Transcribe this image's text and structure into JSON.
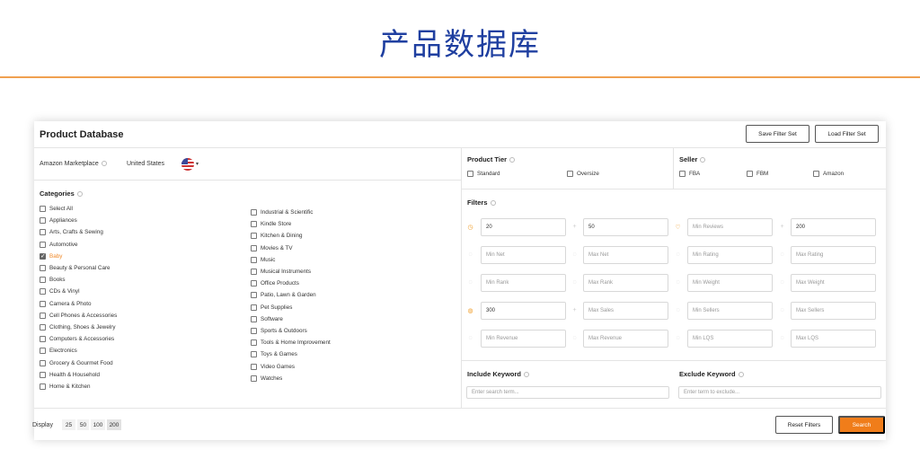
{
  "slide_title": "产品数据库",
  "header": {
    "title": "Product Database",
    "save_filter_set": "Save Filter Set",
    "load_filter_set": "Load Filter Set"
  },
  "marketplace": {
    "label": "Amazon Marketplace",
    "value": "United States"
  },
  "categories": {
    "title": "Categories",
    "col1": [
      "Select All",
      "Appliances",
      "Arts, Crafts & Sewing",
      "Automotive",
      "Baby",
      "Beauty & Personal Care",
      "Books",
      "CDs & Vinyl",
      "Camera & Photo",
      "Cell Phones & Accessories",
      "Clothing, Shoes & Jewelry",
      "Computers & Accessories",
      "Electronics",
      "Grocery & Gourmet Food",
      "Health & Household",
      "Home & Kitchen"
    ],
    "col2": [
      "Industrial & Scientific",
      "Kindle Store",
      "Kitchen & Dining",
      "Movies & TV",
      "Music",
      "Musical Instruments",
      "Office Products",
      "Patio, Lawn & Garden",
      "Pet Supplies",
      "Software",
      "Sports & Outdoors",
      "Tools & Home Improvement",
      "Toys & Games",
      "Video Games",
      "Watches"
    ],
    "checked": "Baby"
  },
  "product_tier": {
    "title": "Product Tier",
    "options": [
      "Standard",
      "Oversize"
    ]
  },
  "seller": {
    "title": "Seller",
    "options": [
      "FBA",
      "FBM",
      "Amazon"
    ]
  },
  "filters": {
    "title": "Filters",
    "rows": [
      [
        {
          "placeholder": "",
          "value": "20"
        },
        {
          "placeholder": "",
          "value": "50"
        },
        {
          "placeholder": "Min Reviews",
          "value": ""
        },
        {
          "placeholder": "",
          "value": "200"
        }
      ],
      [
        {
          "placeholder": "Min Net",
          "value": ""
        },
        {
          "placeholder": "Max Net",
          "value": ""
        },
        {
          "placeholder": "Min Rating",
          "value": ""
        },
        {
          "placeholder": "Max Rating",
          "value": ""
        }
      ],
      [
        {
          "placeholder": "Min Rank",
          "value": ""
        },
        {
          "placeholder": "Max Rank",
          "value": ""
        },
        {
          "placeholder": "Min Weight",
          "value": ""
        },
        {
          "placeholder": "Max Weight",
          "value": ""
        }
      ],
      [
        {
          "placeholder": "",
          "value": "300"
        },
        {
          "placeholder": "Max Sales",
          "value": ""
        },
        {
          "placeholder": "Min Sellers",
          "value": ""
        },
        {
          "placeholder": "Max Sellers",
          "value": ""
        }
      ],
      [
        {
          "placeholder": "Min Revenue",
          "value": ""
        },
        {
          "placeholder": "Max Revenue",
          "value": ""
        },
        {
          "placeholder": "Min LQS",
          "value": ""
        },
        {
          "placeholder": "Max LQS",
          "value": ""
        }
      ]
    ]
  },
  "keywords": {
    "include_title": "Include Keyword",
    "include_placeholder": "Enter search term...",
    "exclude_title": "Exclude Keyword",
    "exclude_placeholder": "Enter term to exclude..."
  },
  "footer": {
    "display_label": "Display",
    "display_options": [
      "25",
      "50",
      "100",
      "200"
    ],
    "display_selected": "200",
    "reset_label": "Reset Filters",
    "search_label": "Search"
  },
  "colors": {
    "accent": "#f07d1a",
    "title_blue": "#1f3fa0"
  }
}
